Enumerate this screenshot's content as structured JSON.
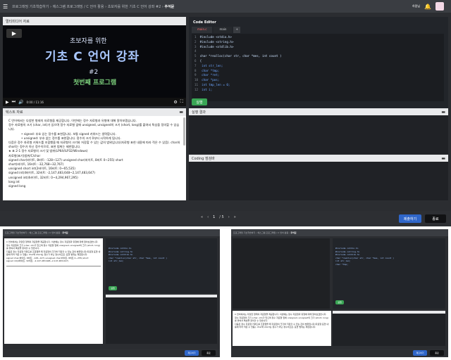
{
  "breadcrumb": {
    "parts": [
      "프로그래밍 기초학습하기",
      "에스그램 프로그래밍 / C 언어 활용",
      "초보자를 위한 기초 C 언어 강좌 #2"
    ],
    "current": "주석문"
  },
  "header": {
    "user_label": "하람님"
  },
  "video": {
    "panel_title": "멀티미디어 자료",
    "intro": "초보자를 위한",
    "title": "기초 C 언어 강좌",
    "number": "#2",
    "subtitle": "첫번째 프로그램",
    "time": "0:00 / 11:16"
  },
  "code_editor": {
    "title": "Code Editor",
    "tabs": [
      "main.c",
      "main"
    ],
    "lines": [
      "#include <stdio.h>",
      "#include <string.h>",
      "#include <stdlib.h>",
      "",
      "char *realloc(char str, char *mes, int count )",
      "{",
      "    int str_len;",
      "    char *tmp;",
      "    char *ret;",
      "    char *pos;",
      "    int tmp_len = 0;",
      "    int i;"
    ],
    "run_label": "실행"
  },
  "text_material": {
    "title": "텍스트 자료",
    "paragraphs": [
      "C 언어에서는 다양한 형태의 자료형을 제공합니다. 이번에는 정수 자료형과 유형에 대해 알아보겠습니다.",
      "정수 자료형의 크기 (char, int)가 있으며 정수 자료형 앞에 unsigned, unsigned의 크기 (short, long)를 붙여서 특성을 정의할 수 있습니다.",
      "• signed: 부호 있는 정수를 표현합니다. 보통 signed 키워드는 생략합니다.",
      "• unsigned: 부호 없는 정수를 표현합니다. 정수의 크기 0부터 시작하게 됩니다.",
      "다음은 정수 자료형 키워드를 조합했을 때 자료형의 크기와 저장할 수 있는 값의 범위입니다(자료형 표현 내용에 따라 적은 수 있음). char와 short는 정수가 아닌 정수이므로, 표현 범위는 제한됩니다.",
      "★ 표 2-1 정수 자료형의 크기 및 범위(LP64/ILP32/Windows)",
      "자료형(표기)범위/C/char",
      "signed char(바이트, 8비트: -128~127) unsigned char(바이트, 8비트 0~255) short",
      "short(바이트, 16비트: -32,768~32,767)",
      "unsigned short int(2바이트, 16비트: 0~65,535)",
      "signed int(4바이트, 32비트: -2,147,483,648~2,147,483,647)",
      "unsigned int(4바이트, 32비트: 0~4,294,967,295)",
      "long int",
      "signed long"
    ]
  },
  "result": {
    "title": "실행 결과"
  },
  "coding_review": {
    "title": "Coding 점검바"
  },
  "pager": {
    "current": "1",
    "total": "/ 5"
  },
  "footer": {
    "submit_label": "제출하기",
    "end_label": "종료"
  },
  "colors": {
    "accent_green": "#3aa655",
    "accent_blue": "#2f66c9",
    "video_title": "#a9c7ff",
    "video_subtitle": "#7ed37e"
  }
}
